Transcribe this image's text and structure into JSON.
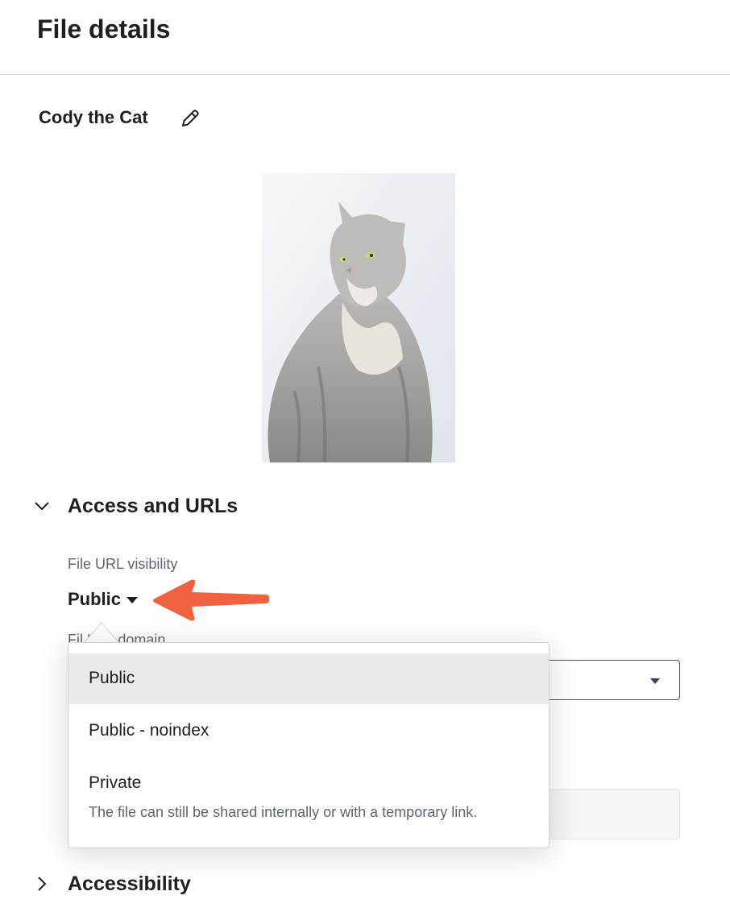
{
  "header": {
    "title": "File details"
  },
  "file": {
    "name": "Cody the Cat",
    "edit_icon": "pencil-icon",
    "preview_subject": "gray tabby cat"
  },
  "sections": {
    "access": {
      "title": "Access and URLs",
      "icon": "chevron-down-icon",
      "expanded": true
    },
    "accessibility": {
      "title": "Accessibility",
      "icon": "chevron-right-icon",
      "expanded": false
    }
  },
  "visibility": {
    "label": "File URL visibility",
    "value": "Public",
    "domain_label_partial": "Fil      L by domain"
  },
  "dropdown": {
    "options": [
      {
        "label": "Public",
        "description": "",
        "highlighted": true
      },
      {
        "label": "Public - noindex",
        "description": ""
      },
      {
        "label": "Private",
        "description": "The file can still be shared internally or with a temporary link."
      }
    ]
  },
  "colors": {
    "annotation_arrow": "#f0623f",
    "highlight": "#eaeaea"
  }
}
